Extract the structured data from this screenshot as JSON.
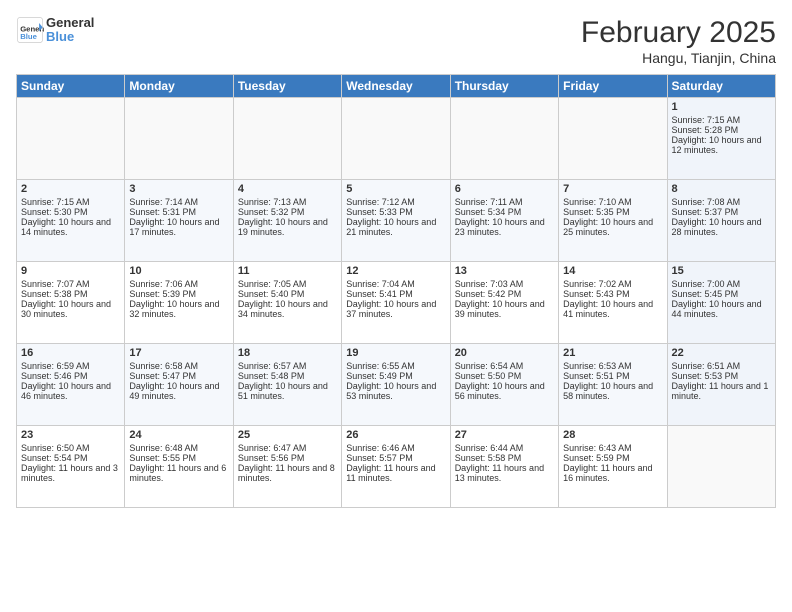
{
  "header": {
    "logo_general": "General",
    "logo_blue": "Blue",
    "month_title": "February 2025",
    "location": "Hangu, Tianjin, China"
  },
  "weekdays": [
    "Sunday",
    "Monday",
    "Tuesday",
    "Wednesday",
    "Thursday",
    "Friday",
    "Saturday"
  ],
  "weeks": [
    [
      {
        "day": "",
        "info": ""
      },
      {
        "day": "",
        "info": ""
      },
      {
        "day": "",
        "info": ""
      },
      {
        "day": "",
        "info": ""
      },
      {
        "day": "",
        "info": ""
      },
      {
        "day": "",
        "info": ""
      },
      {
        "day": "1",
        "info": "Sunrise: 7:15 AM\nSunset: 5:28 PM\nDaylight: 10 hours and 12 minutes."
      }
    ],
    [
      {
        "day": "2",
        "info": "Sunrise: 7:15 AM\nSunset: 5:30 PM\nDaylight: 10 hours and 14 minutes."
      },
      {
        "day": "3",
        "info": "Sunrise: 7:14 AM\nSunset: 5:31 PM\nDaylight: 10 hours and 17 minutes."
      },
      {
        "day": "4",
        "info": "Sunrise: 7:13 AM\nSunset: 5:32 PM\nDaylight: 10 hours and 19 minutes."
      },
      {
        "day": "5",
        "info": "Sunrise: 7:12 AM\nSunset: 5:33 PM\nDaylight: 10 hours and 21 minutes."
      },
      {
        "day": "6",
        "info": "Sunrise: 7:11 AM\nSunset: 5:34 PM\nDaylight: 10 hours and 23 minutes."
      },
      {
        "day": "7",
        "info": "Sunrise: 7:10 AM\nSunset: 5:35 PM\nDaylight: 10 hours and 25 minutes."
      },
      {
        "day": "8",
        "info": "Sunrise: 7:08 AM\nSunset: 5:37 PM\nDaylight: 10 hours and 28 minutes."
      }
    ],
    [
      {
        "day": "9",
        "info": "Sunrise: 7:07 AM\nSunset: 5:38 PM\nDaylight: 10 hours and 30 minutes."
      },
      {
        "day": "10",
        "info": "Sunrise: 7:06 AM\nSunset: 5:39 PM\nDaylight: 10 hours and 32 minutes."
      },
      {
        "day": "11",
        "info": "Sunrise: 7:05 AM\nSunset: 5:40 PM\nDaylight: 10 hours and 34 minutes."
      },
      {
        "day": "12",
        "info": "Sunrise: 7:04 AM\nSunset: 5:41 PM\nDaylight: 10 hours and 37 minutes."
      },
      {
        "day": "13",
        "info": "Sunrise: 7:03 AM\nSunset: 5:42 PM\nDaylight: 10 hours and 39 minutes."
      },
      {
        "day": "14",
        "info": "Sunrise: 7:02 AM\nSunset: 5:43 PM\nDaylight: 10 hours and 41 minutes."
      },
      {
        "day": "15",
        "info": "Sunrise: 7:00 AM\nSunset: 5:45 PM\nDaylight: 10 hours and 44 minutes."
      }
    ],
    [
      {
        "day": "16",
        "info": "Sunrise: 6:59 AM\nSunset: 5:46 PM\nDaylight: 10 hours and 46 minutes."
      },
      {
        "day": "17",
        "info": "Sunrise: 6:58 AM\nSunset: 5:47 PM\nDaylight: 10 hours and 49 minutes."
      },
      {
        "day": "18",
        "info": "Sunrise: 6:57 AM\nSunset: 5:48 PM\nDaylight: 10 hours and 51 minutes."
      },
      {
        "day": "19",
        "info": "Sunrise: 6:55 AM\nSunset: 5:49 PM\nDaylight: 10 hours and 53 minutes."
      },
      {
        "day": "20",
        "info": "Sunrise: 6:54 AM\nSunset: 5:50 PM\nDaylight: 10 hours and 56 minutes."
      },
      {
        "day": "21",
        "info": "Sunrise: 6:53 AM\nSunset: 5:51 PM\nDaylight: 10 hours and 58 minutes."
      },
      {
        "day": "22",
        "info": "Sunrise: 6:51 AM\nSunset: 5:53 PM\nDaylight: 11 hours and 1 minute."
      }
    ],
    [
      {
        "day": "23",
        "info": "Sunrise: 6:50 AM\nSunset: 5:54 PM\nDaylight: 11 hours and 3 minutes."
      },
      {
        "day": "24",
        "info": "Sunrise: 6:48 AM\nSunset: 5:55 PM\nDaylight: 11 hours and 6 minutes."
      },
      {
        "day": "25",
        "info": "Sunrise: 6:47 AM\nSunset: 5:56 PM\nDaylight: 11 hours and 8 minutes."
      },
      {
        "day": "26",
        "info": "Sunrise: 6:46 AM\nSunset: 5:57 PM\nDaylight: 11 hours and 11 minutes."
      },
      {
        "day": "27",
        "info": "Sunrise: 6:44 AM\nSunset: 5:58 PM\nDaylight: 11 hours and 13 minutes."
      },
      {
        "day": "28",
        "info": "Sunrise: 6:43 AM\nSunset: 5:59 PM\nDaylight: 11 hours and 16 minutes."
      },
      {
        "day": "",
        "info": ""
      }
    ]
  ]
}
